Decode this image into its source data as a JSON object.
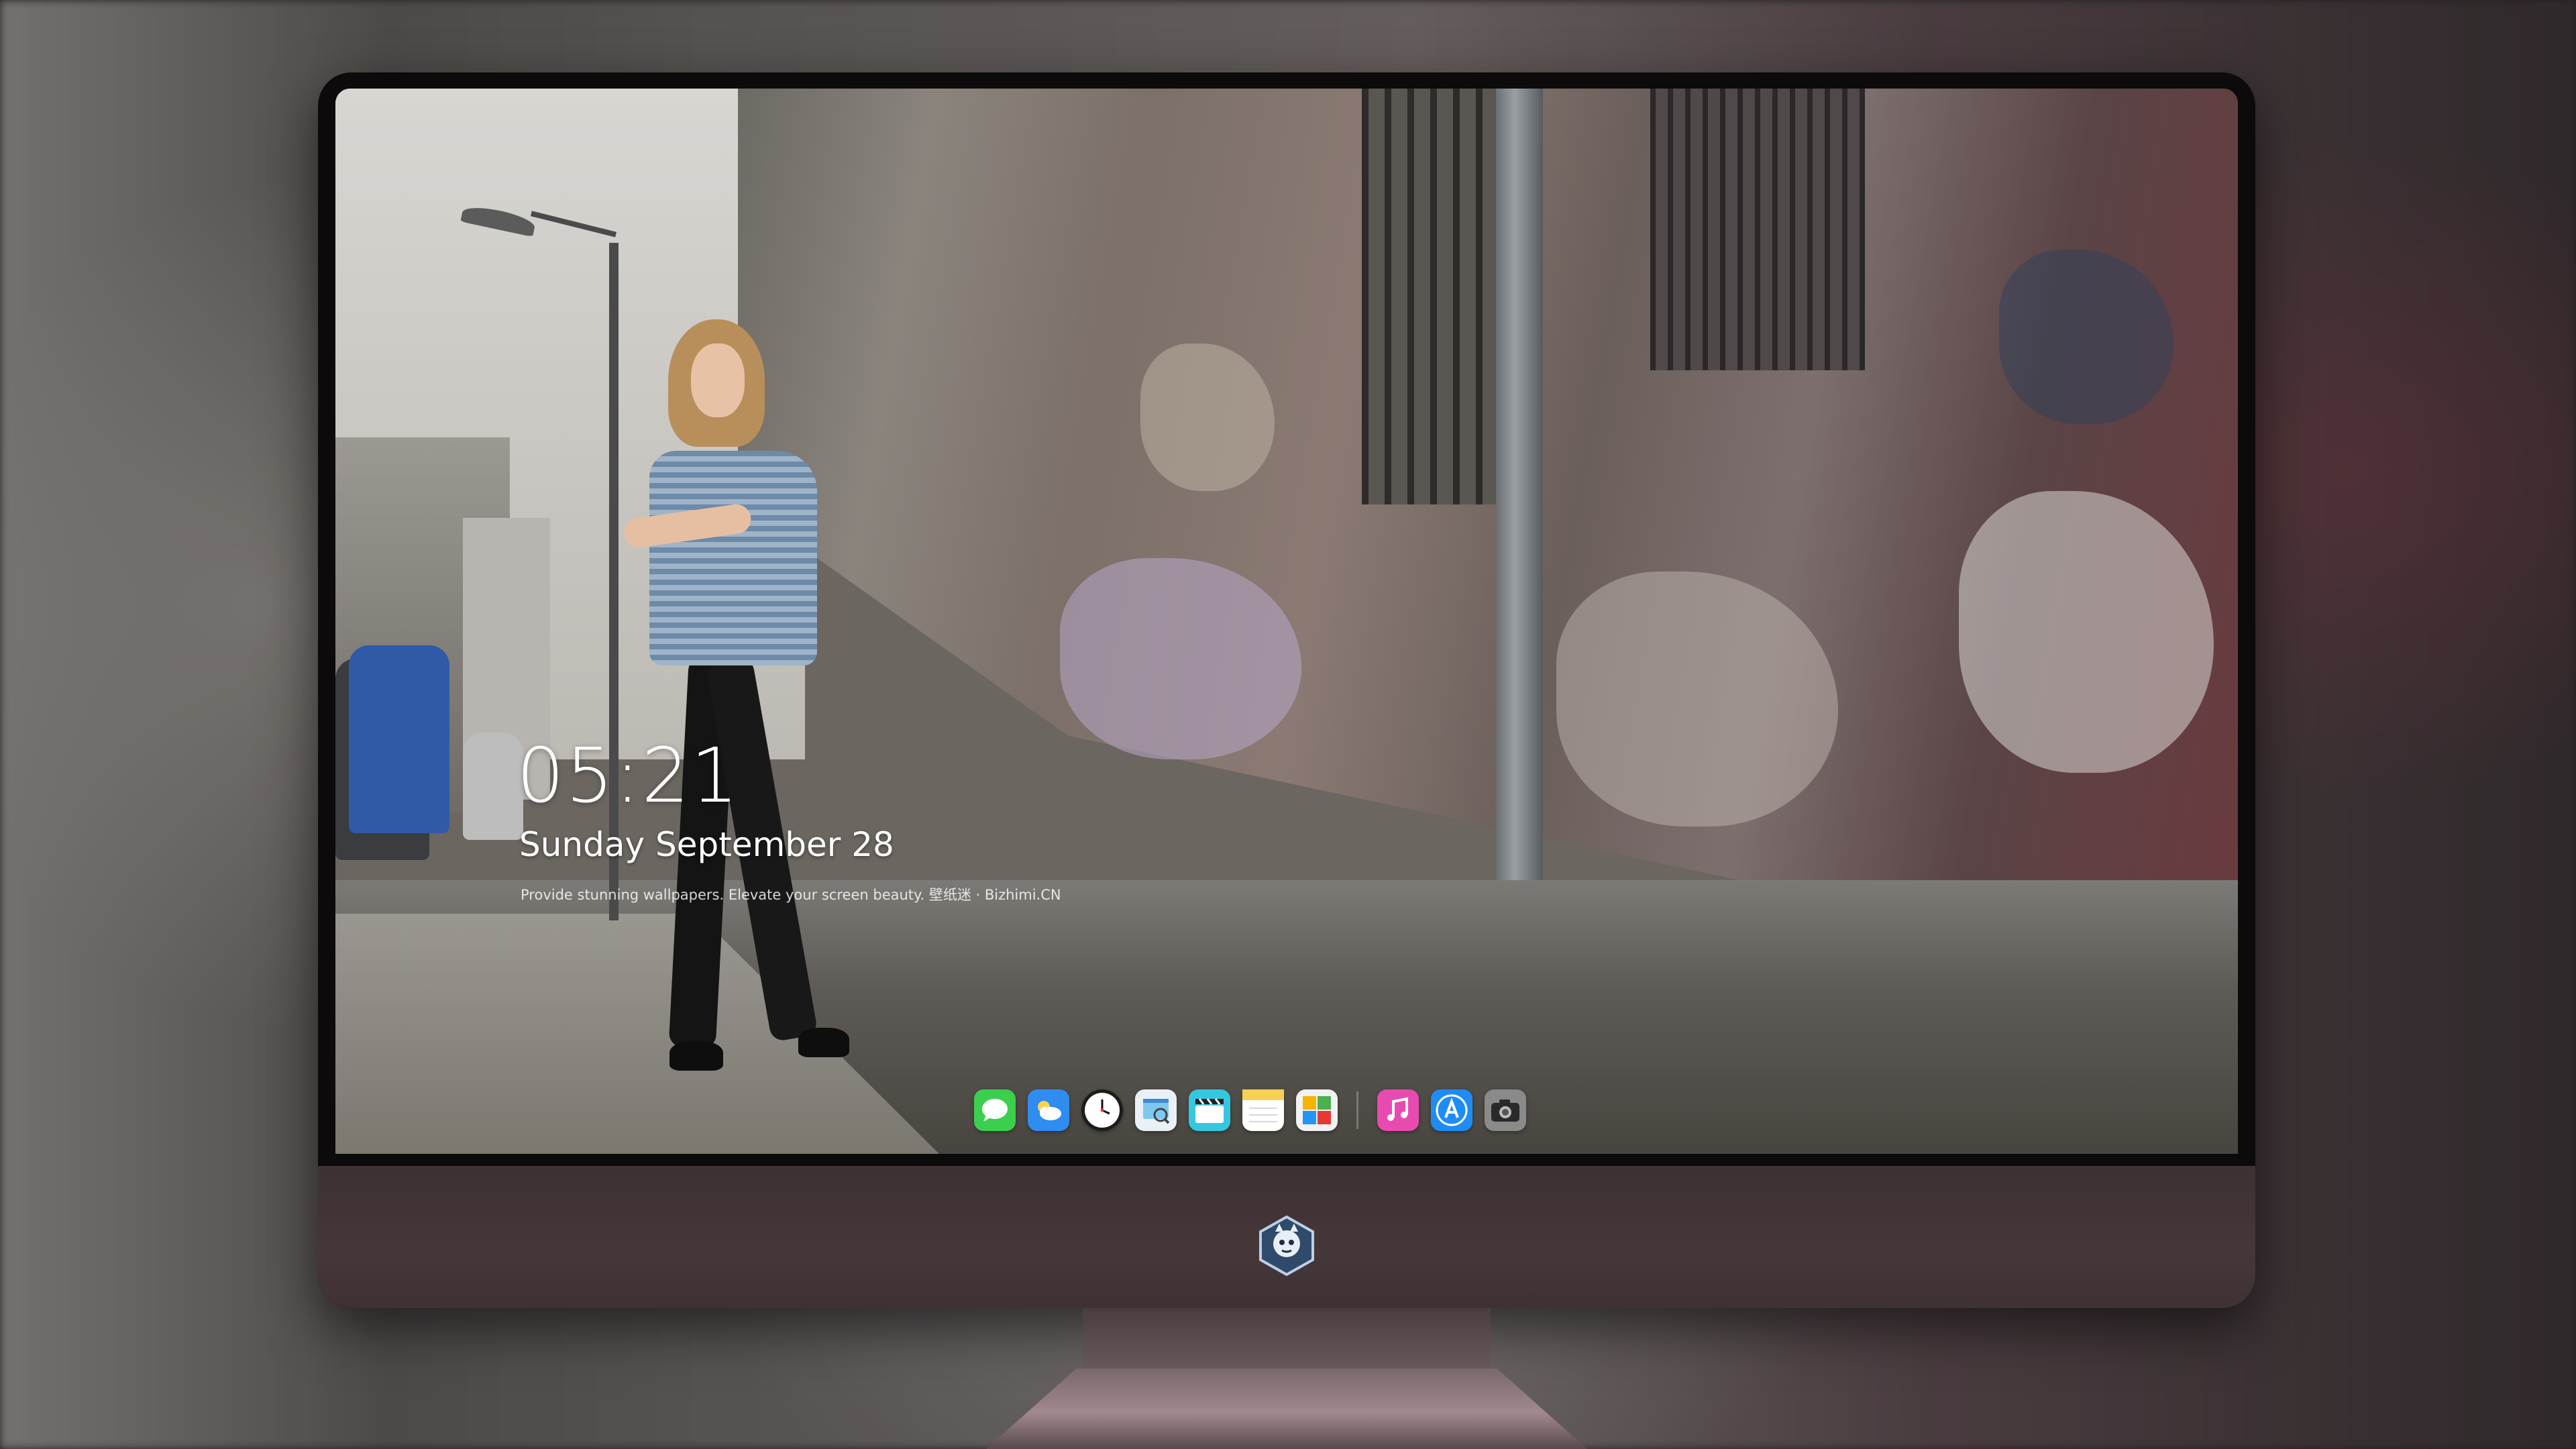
{
  "lock_screen": {
    "time": "05:21",
    "date": "Sunday September  28",
    "tagline": "Provide stunning wallpapers. Elevate your screen beauty. 壁纸迷 · Bizhimi.CN"
  },
  "dock": {
    "items": [
      {
        "name": "messages",
        "icon": "message-bubble-icon",
        "color": "#3ccf4e"
      },
      {
        "name": "weather",
        "icon": "cloud-icon",
        "color": "#2f8cf0"
      },
      {
        "name": "clock",
        "icon": "clock-icon",
        "color": "#ffffff"
      },
      {
        "name": "preview",
        "icon": "preview-icon",
        "color": "#7ec8f0"
      },
      {
        "name": "videos",
        "icon": "clapperboard-icon",
        "color": "#36c7e0"
      },
      {
        "name": "notes",
        "icon": "notes-icon",
        "color": "#f7d154"
      },
      {
        "name": "photos",
        "icon": "photos-icon",
        "color": "#f2f2f2"
      },
      {
        "name": "music",
        "icon": "music-note-icon",
        "color": "#e84bb0"
      },
      {
        "name": "app-store",
        "icon": "app-store-icon",
        "color": "#1f8cf5"
      },
      {
        "name": "camera",
        "icon": "camera-icon",
        "color": "#8a8a8a"
      }
    ]
  },
  "colors": {
    "bezel": "#0c0a0b",
    "chin": "#433537",
    "stand": "#7a686c"
  }
}
